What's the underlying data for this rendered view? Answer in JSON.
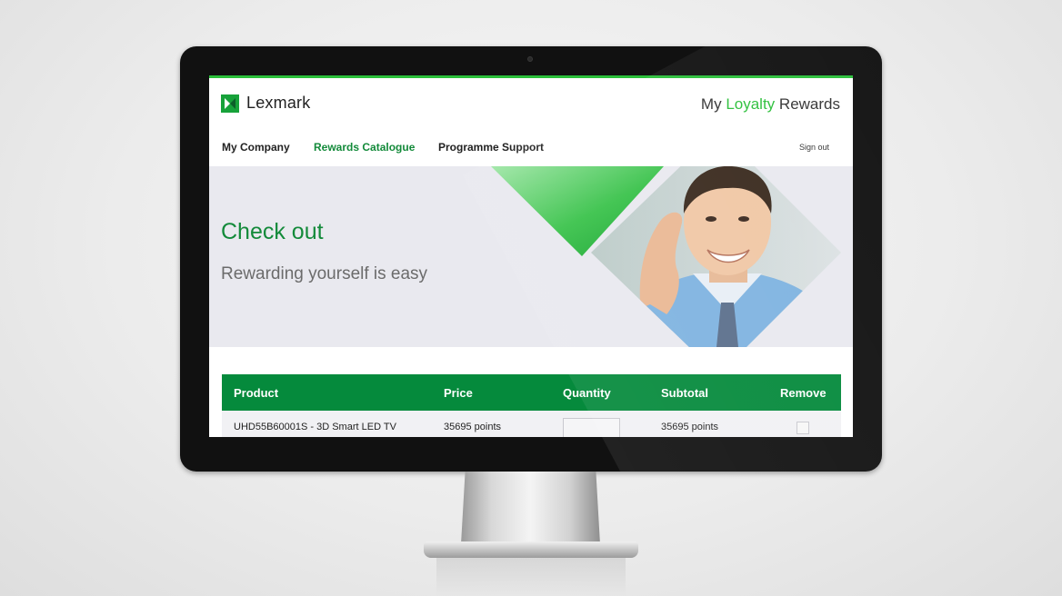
{
  "brand": {
    "logo_text": "Lexmark",
    "title_prefix": "My ",
    "title_accent": "Loyalty",
    "title_suffix": " Rewards",
    "accent_color": "#2bbf3a",
    "primary_green": "#058a3c"
  },
  "nav": {
    "items": [
      {
        "label": "My Company"
      },
      {
        "label": "Rewards Catalogue"
      },
      {
        "label": "Programme Support"
      }
    ],
    "active_index": 1,
    "sign_out": "Sign out"
  },
  "hero": {
    "title": "Check out",
    "subtitle": "Rewarding yourself is easy"
  },
  "cart": {
    "columns": [
      "Product",
      "Price",
      "Quantity",
      "Subtotal",
      "Remove"
    ],
    "rows": [
      {
        "product": "UHD55B60001S - 3D Smart LED TV",
        "price": "35695 points",
        "quantity": "",
        "subtotal": "35695 points"
      }
    ]
  }
}
